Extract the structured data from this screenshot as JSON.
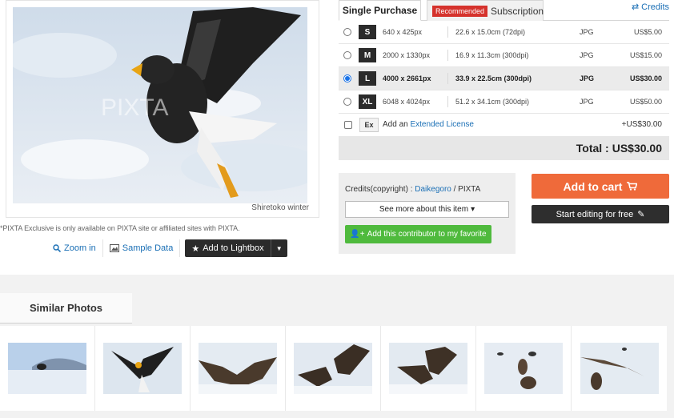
{
  "photo": {
    "caption": "Shiretoko winter",
    "watermark": "PIXTA",
    "exclusive_note": "*PIXTA Exclusive is only available on PIXTA site or affiliated sites with PIXTA."
  },
  "photo_actions": {
    "zoom_label": "Zoom in",
    "sample_label": "Sample Data",
    "lightbox_label": "Add to Lightbox"
  },
  "tabs": {
    "single": "Single Purchase",
    "subscription_badge": "Recommended",
    "subscription": "Subscription",
    "credits": "Credits"
  },
  "sizes": [
    {
      "code": "S",
      "px": "640 x 425px",
      "cm": "22.6 x 15.0cm (72dpi)",
      "format": "JPG",
      "price": "US$5.00",
      "selected": false
    },
    {
      "code": "M",
      "px": "2000 x 1330px",
      "cm": "16.9 x 11.3cm (300dpi)",
      "format": "JPG",
      "price": "US$15.00",
      "selected": false
    },
    {
      "code": "L",
      "px": "4000 x 2661px",
      "cm": "33.9 x 22.5cm (300dpi)",
      "format": "JPG",
      "price": "US$30.00",
      "selected": true
    },
    {
      "code": "XL",
      "px": "6048 x 4024px",
      "cm": "51.2 x 34.1cm (300dpi)",
      "format": "JPG",
      "price": "US$50.00",
      "selected": false
    }
  ],
  "license": {
    "code": "Ex",
    "prefix": "Add an",
    "link": "Extended License",
    "price": "+US$30.00"
  },
  "total": {
    "label": "Total : ",
    "value": "US$30.00"
  },
  "contributor": {
    "credit_prefix": "Credits(copyright) : ",
    "name": "Daikegoro",
    "suffix": " / PIXTA",
    "see_more": "See more about this item",
    "favorite": "Add this contributor to my favorite"
  },
  "cart": {
    "add_to_cart": "Add to cart",
    "edit": "Start editing for free"
  },
  "similar": {
    "title": "Similar Photos",
    "thumbs": [
      "similar-photo-1",
      "similar-photo-2",
      "similar-photo-3",
      "similar-photo-4",
      "similar-photo-5",
      "similar-photo-6",
      "similar-photo-7"
    ]
  },
  "colors": {
    "accent_orange": "#ef6a3a",
    "link_blue": "#1a6fb5",
    "favorite_green": "#4fba3d",
    "recommended_red": "#d5322c",
    "dark_button": "#2e2e2e"
  }
}
